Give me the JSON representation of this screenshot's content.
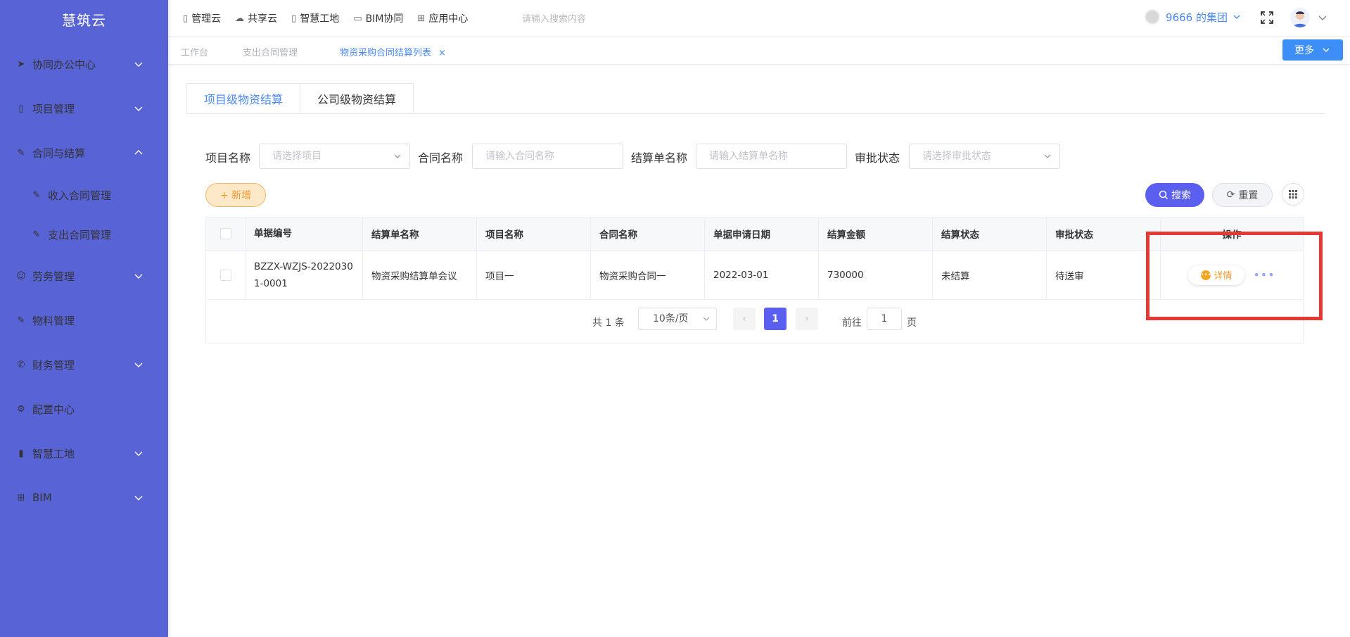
{
  "app": {
    "brand": "慧筑云"
  },
  "colors": {
    "sidebar": "#5863d6",
    "primary": "#5b5ff0",
    "accent_blue": "#4a88f5",
    "warning": "#f09a30",
    "highlight": "#e53935"
  },
  "sidebar": {
    "items": [
      {
        "label": "协同办公中心",
        "icon": "send-icon",
        "chevron": "down"
      },
      {
        "label": "项目管理",
        "icon": "book-icon",
        "chevron": "down"
      },
      {
        "label": "合同与结算",
        "icon": "edit-icon",
        "chevron": "up"
      },
      {
        "label": "收入合同管理",
        "icon": "edit-icon"
      },
      {
        "label": "支出合同管理",
        "icon": "edit-icon"
      },
      {
        "label": "劳务管理",
        "icon": "users-icon",
        "chevron": "down"
      },
      {
        "label": "物料管理",
        "icon": "edit-icon"
      },
      {
        "label": "财务管理",
        "icon": "phone-icon",
        "chevron": "down"
      },
      {
        "label": "配置中心",
        "icon": "gear-icon"
      },
      {
        "label": "智慧工地",
        "icon": "bar-chart-icon",
        "chevron": "down"
      },
      {
        "label": "BIM",
        "icon": "grid-icon",
        "chevron": "down"
      }
    ]
  },
  "topnav": {
    "items": [
      {
        "label": "管理云",
        "icon": "doc-icon"
      },
      {
        "label": "共享云",
        "icon": "cloud-icon"
      },
      {
        "label": "智慧工地",
        "icon": "doc-icon"
      },
      {
        "label": "BIM协同",
        "icon": "wallet-icon"
      },
      {
        "label": "应用中心",
        "icon": "apps-icon"
      }
    ],
    "search_placeholder": "请输入搜索内容",
    "org_name": "9666 的集团"
  },
  "page_tabs": {
    "items": [
      {
        "label": "工作台"
      },
      {
        "label": "支出合同管理"
      },
      {
        "label": "物资采购合同结算列表"
      }
    ],
    "close": "×",
    "more_label": "更多"
  },
  "content_tabs": {
    "items": [
      {
        "label": "项目级物资结算"
      },
      {
        "label": "公司级物资结算"
      }
    ]
  },
  "filters": {
    "project_label": "项目名称",
    "project_placeholder": "请选择项目",
    "contract_label": "合同名称",
    "contract_placeholder": "请输入合同名称",
    "settle_label": "结算单名称",
    "settle_placeholder": "请输入结算单名称",
    "approval_label": "审批状态",
    "approval_placeholder": "请选择审批状态"
  },
  "actions": {
    "add_label": "+ 新增",
    "search_label": "搜索",
    "reset_label": "重置"
  },
  "table": {
    "headers": [
      "单据编号",
      "结算单名称",
      "项目名称",
      "合同名称",
      "单据申请日期",
      "结算金额",
      "结算状态",
      "审批状态",
      "操作"
    ],
    "rows": [
      {
        "doc_no": "BZZX-WZJS-20220301-0001",
        "settle_name": "物资采购结算单会议",
        "project": "项目一",
        "contract": "物资采购合同一",
        "date": "2022-03-01",
        "amount": "730000",
        "settle_status": "未结算",
        "approval_status": "待送审",
        "detail_label": "详情",
        "more": "•••"
      }
    ]
  },
  "pagination": {
    "total": "共 1 条",
    "page_size": "10条/页",
    "current": "1",
    "goto_label": "前往",
    "goto_value": "1",
    "goto_unit": "页"
  }
}
